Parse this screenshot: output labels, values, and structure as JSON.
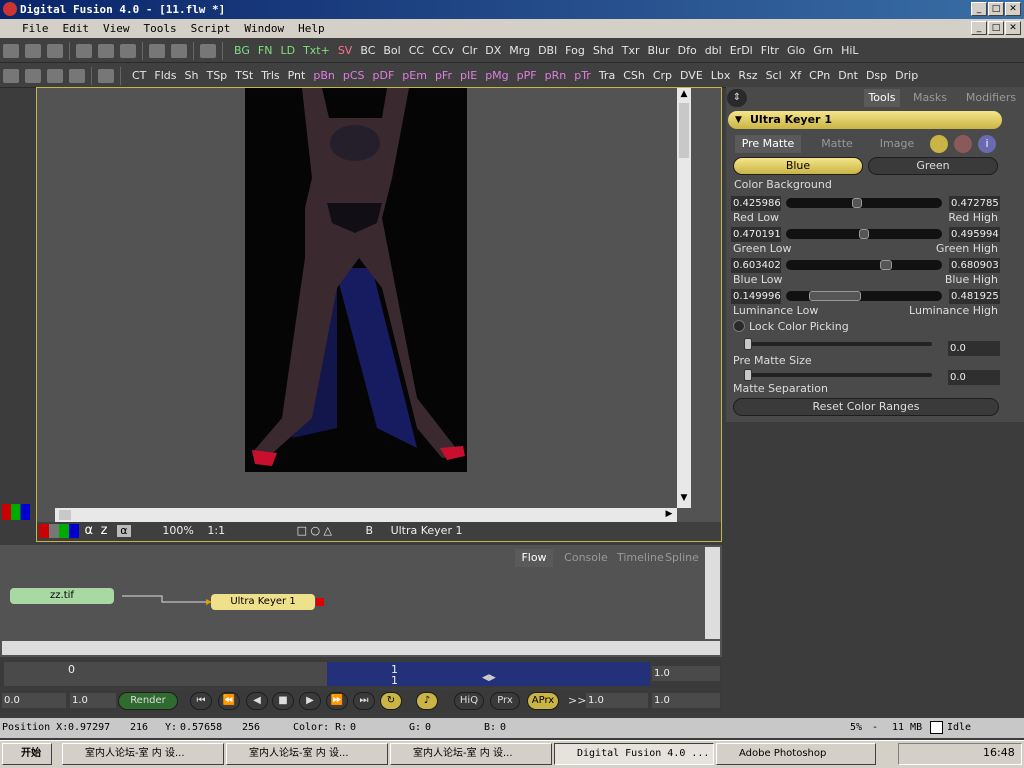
{
  "window": {
    "title": "Digital Fusion 4.0 - [11.flw *]"
  },
  "menu": [
    "File",
    "Edit",
    "View",
    "Tools",
    "Script",
    "Window",
    "Help"
  ],
  "toolbar1": [
    {
      "t": "BG",
      "c": "g"
    },
    {
      "t": "FN",
      "c": "g"
    },
    {
      "t": "LD",
      "c": "g"
    },
    {
      "t": "Txt+",
      "c": "g"
    },
    {
      "t": "SV",
      "c": "r"
    },
    {
      "t": "BC"
    },
    {
      "t": "Bol"
    },
    {
      "t": "CC"
    },
    {
      "t": "CCv"
    },
    {
      "t": "Clr"
    },
    {
      "t": "DX"
    },
    {
      "t": "Mrg"
    },
    {
      "t": "DBl"
    },
    {
      "t": "Fog"
    },
    {
      "t": "Shd"
    },
    {
      "t": "Txr"
    },
    {
      "t": "Blur"
    },
    {
      "t": "Dfo"
    },
    {
      "t": "dbl"
    },
    {
      "t": "ErDl"
    },
    {
      "t": "Fltr"
    },
    {
      "t": "Glo"
    },
    {
      "t": "Grn"
    },
    {
      "t": "HiL"
    }
  ],
  "toolbar2": [
    {
      "t": "CT"
    },
    {
      "t": "Flds"
    },
    {
      "t": "Sh"
    },
    {
      "t": "TSp"
    },
    {
      "t": "TSt"
    },
    {
      "t": "Trls"
    },
    {
      "t": "Pnt"
    },
    {
      "t": "pBn",
      "c": "m"
    },
    {
      "t": "pCS",
      "c": "m"
    },
    {
      "t": "pDF",
      "c": "m"
    },
    {
      "t": "pEm",
      "c": "m"
    },
    {
      "t": "pFr",
      "c": "m"
    },
    {
      "t": "pIE",
      "c": "m"
    },
    {
      "t": "pMg",
      "c": "m"
    },
    {
      "t": "pPF",
      "c": "m"
    },
    {
      "t": "pRn",
      "c": "m"
    },
    {
      "t": "pTr",
      "c": "m"
    },
    {
      "t": "Tra"
    },
    {
      "t": "CSh"
    },
    {
      "t": "Crp"
    },
    {
      "t": "DVE"
    },
    {
      "t": "Lbx"
    },
    {
      "t": "Rsz"
    },
    {
      "t": "Scl"
    },
    {
      "t": "Xf"
    },
    {
      "t": "CPn"
    },
    {
      "t": "Dnt"
    },
    {
      "t": "Dsp"
    },
    {
      "t": "Drip"
    }
  ],
  "viewer": {
    "zoom": "100%",
    "ratio": "1:1",
    "name": "Ultra Keyer 1",
    "alpha": "α",
    "z": "z",
    "b": "B"
  },
  "panel": {
    "tabs": [
      "Tools",
      "Masks",
      "Modifiers"
    ],
    "tool": "Ultra Keyer 1",
    "subtabs": [
      "Pre Matte",
      "Matte",
      "Image"
    ],
    "blue": "Blue",
    "green": "Green",
    "colorbg": "Color Background",
    "rows": [
      {
        "lo": "0.425986",
        "hi": "0.472785",
        "ll": "Red Low",
        "hl": "Red High",
        "t1": 0.42,
        "t2": 0.47
      },
      {
        "lo": "0.470191",
        "hi": "0.495994",
        "ll": "Green Low",
        "hl": "Green High",
        "t1": 0.47,
        "t2": 0.5
      },
      {
        "lo": "0.603402",
        "hi": "0.680903",
        "ll": "Blue Low",
        "hl": "Blue High",
        "t1": 0.6,
        "t2": 0.68
      },
      {
        "lo": "0.149996",
        "hi": "0.481925",
        "ll": "Luminance Low",
        "hl": "Luminance High",
        "t1": 0.15,
        "t2": 0.48
      }
    ],
    "lock": "Lock Color Picking",
    "prematte_size": "Pre Matte Size",
    "pms_val": "0.0",
    "separation": "Matte Separation",
    "sep_val": "0.0",
    "reset": "Reset Color Ranges"
  },
  "flow": {
    "tabs": [
      "Flow",
      "Console",
      "Timeline",
      "Spline"
    ],
    "node1": "zz.tif",
    "node2": "Ultra Keyer 1"
  },
  "timeline": {
    "start": "0",
    "cur": "1",
    "curlow": "1",
    "end": "1.0"
  },
  "controls": {
    "a": "0.0",
    "b": "1.0",
    "render": "Render",
    "hiq": "HiQ",
    "prx": "Prx",
    "aprx": "APrx",
    "c": "1.0",
    "d": "1.0",
    "chev": ">>"
  },
  "status": {
    "posx_l": "Position X:",
    "posx": "0.97297",
    "px": "216",
    "posy_l": "Y:",
    "posy": "0.57658",
    "py": "256",
    "color_l": "Color: R:",
    "r": "0",
    "g_l": "G:",
    "g": "0",
    "b_l": "B:",
    "b": "0",
    "pct": "5%",
    "dash": "-",
    "mem": "11 MB",
    "state": "Idle"
  },
  "taskbar": {
    "start": "开始",
    "tasks": [
      "室内人论坛-室 内 设...",
      "室内人论坛-室 内 设...",
      "室内人论坛-室 内 设...",
      "Digital Fusion 4.0 ...",
      "Adobe Photoshop"
    ],
    "clock": "16:48"
  }
}
